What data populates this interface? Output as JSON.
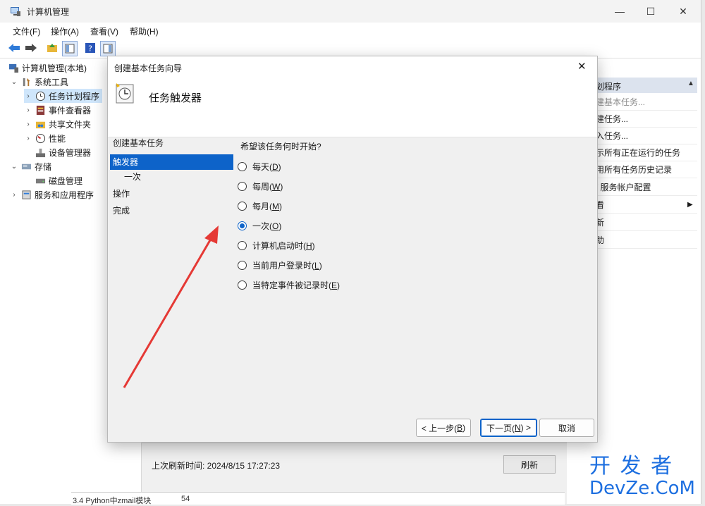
{
  "window": {
    "title": "计算机管理",
    "minimize": "—",
    "maximize": "☐",
    "close": "✕"
  },
  "menu": [
    "文件(F)",
    "操作(A)",
    "查看(V)",
    "帮助(H)"
  ],
  "tree": {
    "root": "计算机管理(本地)",
    "system_tools": "系统工具",
    "task_scheduler": "任务计划程序",
    "event_viewer": "事件查看器",
    "shared_folders": "共享文件夹",
    "performance": "性能",
    "device_manager": "设备管理器",
    "storage": "存储",
    "disk_management": "磁盘管理",
    "services_apps": "服务和应用程序"
  },
  "actions": {
    "header": "划程序",
    "items": [
      "建基本任务...",
      "建任务...",
      "入任务...",
      "示所有正在运行的任务",
      "用所有任务历史记录",
      "T 服务帐户配置",
      "看",
      "新",
      "助"
    ]
  },
  "background_panel": {
    "last_refresh_label": "上次刷新时间: 2024/8/15 17:27:23",
    "refresh_button": "刷新",
    "row_text": "3.4 Python中zmail模块",
    "row_value": "54"
  },
  "dialog": {
    "title": "创建基本任务向导",
    "close": "✕",
    "header_title": "任务触发器",
    "steps": [
      {
        "label": "创建基本任务"
      },
      {
        "label": "触发器"
      },
      {
        "label": "一次"
      },
      {
        "label": "操作"
      },
      {
        "label": "完成"
      }
    ],
    "question": "希望该任务何时开始?",
    "options": [
      {
        "text": "每天(",
        "key": "D",
        "checked": false
      },
      {
        "text": "每周(",
        "key": "W",
        "checked": false
      },
      {
        "text": "每月(",
        "key": "M",
        "checked": false
      },
      {
        "text": "一次(",
        "key": "O",
        "checked": true
      },
      {
        "text": "计算机启动时(",
        "key": "H",
        "checked": false
      },
      {
        "text": "当前用户登录时(",
        "key": "L",
        "checked": false
      },
      {
        "text": "当特定事件被记录时(",
        "key": "E",
        "checked": false
      }
    ],
    "buttons": {
      "back": "< 上一步(",
      "back_key": "B",
      "next": "下一页(",
      "next_key": "N",
      "next_suffix": ") >",
      "cancel": "取消"
    }
  },
  "watermark": {
    "line1": "开 发 者",
    "line2": "DevZe.CoM"
  },
  "colors": {
    "accent": "#0d63c9",
    "arrow": "#e53935"
  }
}
